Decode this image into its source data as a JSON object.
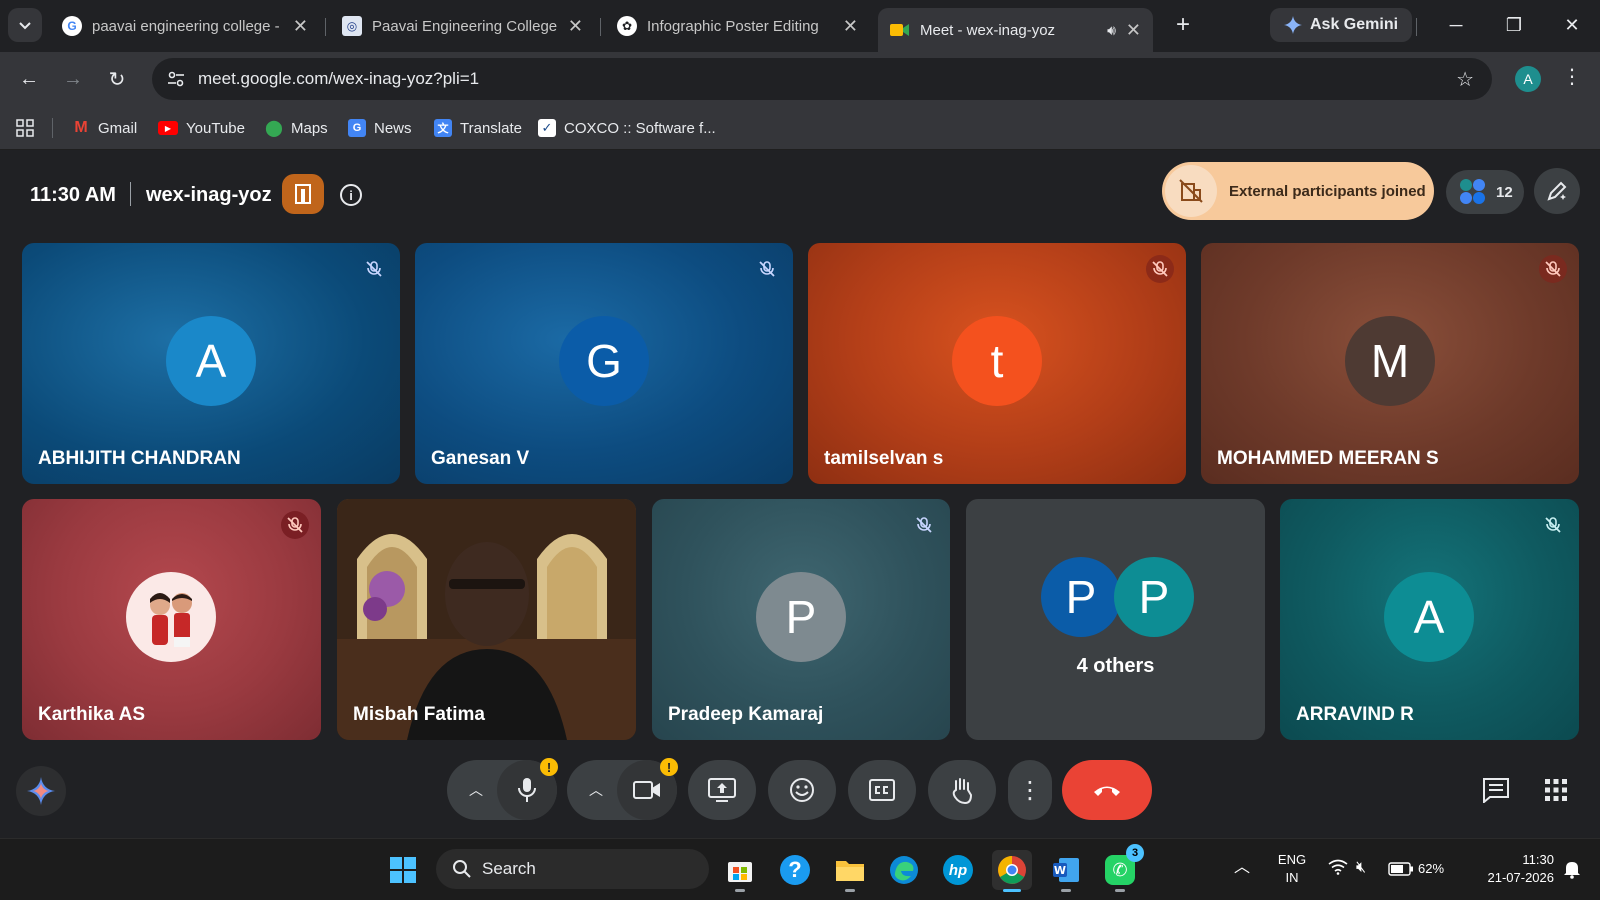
{
  "browser": {
    "tabs": [
      {
        "label": "paavai engineering college -",
        "favicon": "google-icon"
      },
      {
        "label": "Paavai Engineering College",
        "favicon": "college-logo-icon"
      },
      {
        "label": "Infographic Poster Editing",
        "favicon": "chatgpt-icon"
      },
      {
        "label": "Meet - wex-inag-yoz",
        "favicon": "meet-icon",
        "active": true
      }
    ],
    "ask_gemini": "Ask Gemini",
    "url": "meet.google.com/wex-inag-yoz?pli=1",
    "profile_initial": "A",
    "bookmarks": [
      {
        "label": "Gmail",
        "icon": "gmail-icon"
      },
      {
        "label": "YouTube",
        "icon": "youtube-icon"
      },
      {
        "label": "Maps",
        "icon": "maps-icon"
      },
      {
        "label": "News",
        "icon": "news-icon"
      },
      {
        "label": "Translate",
        "icon": "translate-icon"
      },
      {
        "label": "COXCO :: Software f...",
        "icon": "coxco-icon"
      }
    ]
  },
  "meet": {
    "time": "11:30 AM",
    "code": "wex-inag-yoz",
    "external_notice": "External participants joined",
    "participant_count": "12",
    "participants_row1": [
      {
        "name": "ABHIJITH CHANDRAN",
        "initial": "A",
        "avatar_color": "#1a88c9",
        "muted": true
      },
      {
        "name": "Ganesan V",
        "initial": "G",
        "avatar_color": "#0b5ca8",
        "muted": true
      },
      {
        "name": "tamilselvan s",
        "initial": "t",
        "avatar_color": "#f4511e",
        "muted": true
      },
      {
        "name": "MOHAMMED MEERAN S",
        "initial": "M",
        "avatar_color": "#4e3a33",
        "muted": true
      }
    ],
    "participants_row2": [
      {
        "name": "Karthika AS",
        "muted": true
      },
      {
        "name": "Misbah Fatima",
        "muted": false
      },
      {
        "name": "Pradeep Kamaraj",
        "initial": "P",
        "avatar_color": "#7e8a90",
        "muted": true
      },
      {
        "name": "4 others",
        "initials": [
          "P",
          "P"
        ]
      },
      {
        "name": "ARRAVIND R",
        "initial": "A",
        "avatar_color": "#0d8d94",
        "muted": true
      }
    ],
    "warning_mark": "!"
  },
  "taskbar": {
    "search_placeholder": "Search",
    "whatsapp_badge": "3",
    "language": "ENG",
    "region": "IN",
    "battery": "62%",
    "clock_time": "11:30",
    "clock_date": "21-07-2026"
  }
}
